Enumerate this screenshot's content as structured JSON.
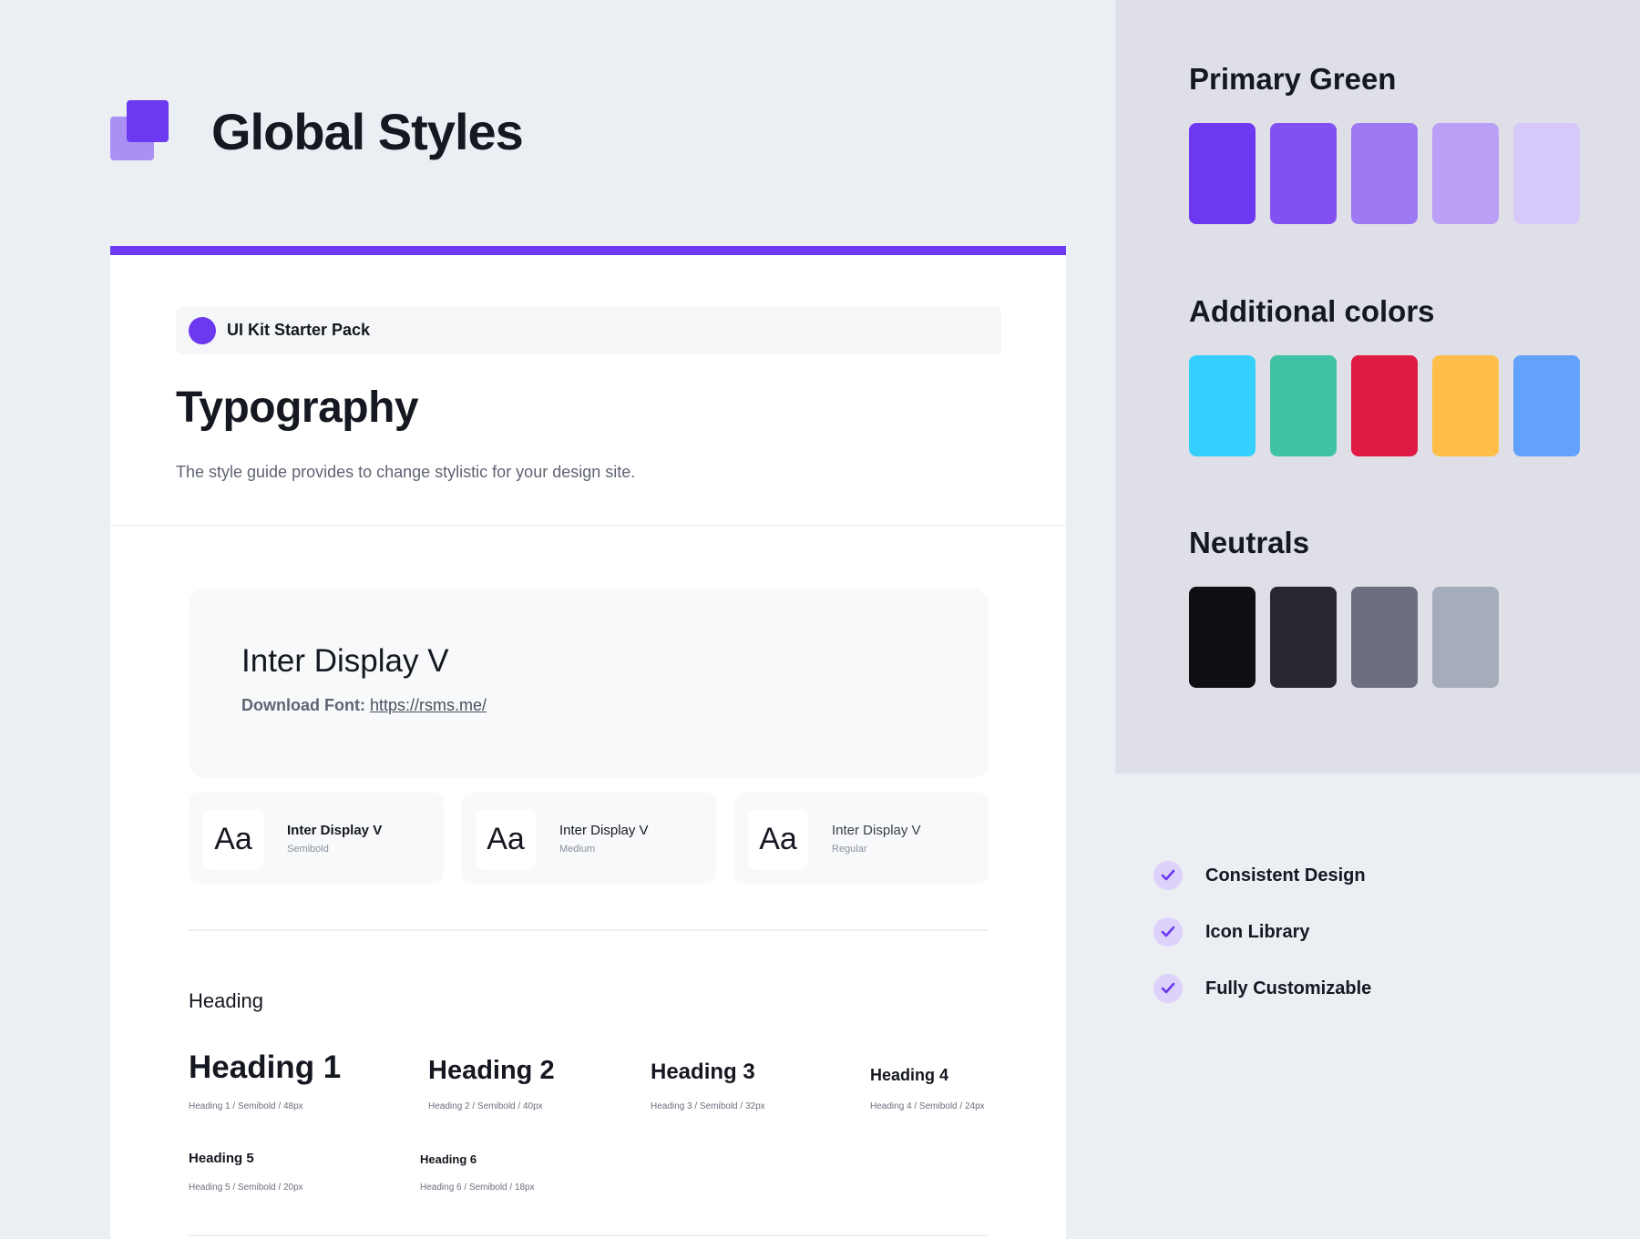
{
  "header": {
    "title": "Global Styles"
  },
  "card": {
    "tag_label": "UI Kit Starter Pack",
    "section_title": "Typography",
    "description": "The style guide provides to change stylistic for your design site.",
    "font": {
      "name": "Inter Display V",
      "download_label": "Download Font:",
      "download_link": "https://rsms.me/"
    },
    "weights": [
      {
        "glyph": "Aa",
        "name": "Inter Display V",
        "weight": "Semibold"
      },
      {
        "glyph": "Aa",
        "name": "Inter Display V",
        "weight": "Medium"
      },
      {
        "glyph": "Aa",
        "name": "Inter Display V",
        "weight": "Regular"
      }
    ],
    "heading_section_label": "Heading",
    "headings": [
      {
        "label": "Heading 1",
        "meta": "Heading 1 / Semibold / 48px"
      },
      {
        "label": "Heading 2",
        "meta": "Heading 2 / Semibold / 40px"
      },
      {
        "label": "Heading 3",
        "meta": "Heading 3 / Semibold / 32px"
      },
      {
        "label": "Heading 4",
        "meta": "Heading 4 / Semibold / 24px"
      },
      {
        "label": "Heading 5",
        "meta": "Heading 5 / Semibold / 20px"
      },
      {
        "label": "Heading 6",
        "meta": "Heading 6 / Semibold / 18px"
      }
    ]
  },
  "palettes": [
    {
      "title": "Primary Green",
      "colors": [
        "#6c38f0",
        "#8350f2",
        "#9d79f4",
        "#b9a0f6",
        "#d6c9fa"
      ]
    },
    {
      "title": "Additional colors",
      "colors": [
        "#35cffd",
        "#40c3a4",
        "#e01b43",
        "#ffbd4a",
        "#63a2fc"
      ]
    },
    {
      "title": "Neutrals",
      "colors": [
        "#0f0f13",
        "#272732",
        "#6b6f80",
        "#a5adba"
      ]
    }
  ],
  "features": [
    {
      "icon": "check-icon",
      "label": "Consistent Design"
    },
    {
      "icon": "check-icon",
      "label": "Icon Library"
    },
    {
      "icon": "check-icon",
      "label": "Fully Customizable"
    }
  ],
  "theme": {
    "accent": "#6c38f0",
    "accent_light": "#aa8ff5"
  }
}
